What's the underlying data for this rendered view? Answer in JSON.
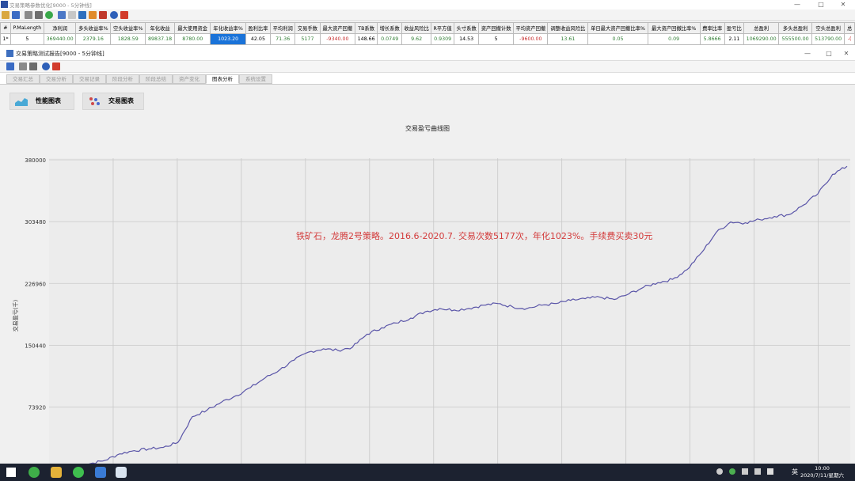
{
  "outer_window": {
    "title": "交易策略参数优化[9000 - 5分钟线]"
  },
  "results_table": {
    "headers": [
      "#",
      "P.MaLength",
      "净利润",
      "多头收益率%",
      "空头收益率%",
      "年化收益",
      "最大使用资金",
      "年化收益率%",
      "盈利比率",
      "平均利润",
      "交易手数",
      "最大资产回撤",
      "TB系数",
      "增长系数",
      "收益风险比",
      "R平方值",
      "头寸系数",
      "资产回撤计数",
      "平均资产回撤",
      "调整收益风险比",
      "单日最大资产回撤比率%",
      "最大资产回撤比率%",
      "费率比率",
      "盈亏比",
      "总盈利",
      "多头总盈利",
      "空头总盈利",
      "总"
    ],
    "row": [
      "1*",
      "5",
      "369440.00",
      "2379.16",
      "1828.59",
      "89837.18",
      "8780.00",
      "1023.20",
      "42.05",
      "71.36",
      "5177",
      "-9340.00",
      "148.66",
      "0.0749",
      "9.62",
      "0.9309",
      "14.53",
      "5",
      "-9600.00",
      "13.61",
      "0.05",
      "0.09",
      "5.8666",
      "2.11",
      "1069290.00",
      "555500.00",
      "513790.00",
      "-("
    ]
  },
  "inner_window": {
    "title": "交易策略测试报告[9000 - 5分钟线]"
  },
  "tabs": [
    "交易汇总",
    "交易分析",
    "交易记录",
    "阶段分析",
    "阶段总结",
    "资产变化",
    "图表分析",
    "系统设置"
  ],
  "active_tab": "图表分析",
  "chart_buttons": {
    "performance": "性能图表",
    "trade": "交易图表"
  },
  "chart_data": {
    "type": "line",
    "title": "交易盈亏曲线图",
    "ylabel": "交易盈亏(千)",
    "xlabel": "",
    "y_ticks": [
      73920,
      150440,
      226960,
      303480,
      380000
    ],
    "ylim": [
      0,
      380000
    ],
    "grid": true,
    "annotation": "铁矿石，龙腾2号策略。2016.6-2020.7. 交易次数5177次，年化1023%。手续费买卖30元",
    "line_color": "#5a55a8",
    "series": [
      {
        "values": [
          0,
          4000,
          8000,
          16000,
          20000,
          22000,
          24000,
          30000,
          62000,
          70000,
          80000,
          88000,
          98000,
          110000,
          120000,
          132000,
          142000,
          146000,
          144000,
          148000,
          164000,
          172000,
          178000,
          184000,
          192000,
          196000,
          194000,
          196000,
          200000,
          202000,
          198000,
          196000,
          200000,
          202000,
          206000,
          208000,
          210000,
          207000,
          214000,
          222000,
          228000,
          232000,
          244000,
          265000,
          290000,
          303000,
          302000,
          306000,
          310000,
          312000,
          324000,
          338000,
          362000,
          372000
        ]
      }
    ]
  },
  "taskbar": {
    "time": "10:00",
    "date": "2020/7/11/星期六",
    "ime": "英"
  }
}
